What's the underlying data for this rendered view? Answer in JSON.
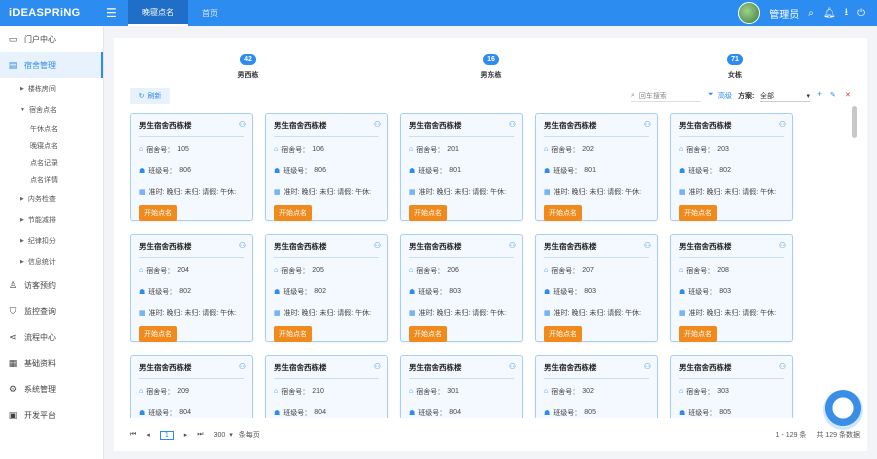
{
  "header": {
    "logo": "iDEASPRiNG",
    "tabs": [
      {
        "label": "晚寝点名",
        "active": true
      },
      {
        "label": "首页",
        "active": false
      }
    ],
    "user": "管理员"
  },
  "sidebar": {
    "items": [
      {
        "label": "门户中心",
        "icon": "monitor-icon"
      },
      {
        "label": "宿舍管理",
        "icon": "document-icon",
        "active": true
      },
      {
        "label": "楼栋房间",
        "type": "group"
      },
      {
        "label": "宿舍点名",
        "type": "group-open"
      },
      {
        "label": "午休点名",
        "type": "leaf"
      },
      {
        "label": "晚寝点名",
        "type": "leaf"
      },
      {
        "label": "点名记录",
        "type": "leaf"
      },
      {
        "label": "点名详情",
        "type": "leaf"
      },
      {
        "label": "内务检查",
        "type": "group"
      },
      {
        "label": "节能减排",
        "type": "group"
      },
      {
        "label": "纪律扣分",
        "type": "group"
      },
      {
        "label": "信息统计",
        "type": "group"
      },
      {
        "label": "访客预约",
        "icon": "user-icon"
      },
      {
        "label": "监控查询",
        "icon": "shield-icon"
      },
      {
        "label": "流程中心",
        "icon": "share-icon"
      },
      {
        "label": "基础资料",
        "icon": "grid-icon"
      },
      {
        "label": "系统管理",
        "icon": "gear-icon"
      },
      {
        "label": "开发平台",
        "icon": "code-icon"
      }
    ]
  },
  "stats": [
    {
      "count": "42",
      "label": "男西栋"
    },
    {
      "count": "16",
      "label": "男东栋"
    },
    {
      "count": "71",
      "label": "女栋"
    }
  ],
  "toolbar": {
    "refresh": "刷新",
    "search_placeholder": "回车搜索",
    "advanced": "高级",
    "scheme_label": "方案:",
    "scheme_value": "全部"
  },
  "card_labels": {
    "dorm": "宿舍号：",
    "class": "班级号：",
    "status": "准时: 晚归: 未归: 请假: 午休:",
    "button": "开始点名"
  },
  "cards": [
    {
      "title": "男生宿舍西栋楼",
      "dorm": "105",
      "class": "806"
    },
    {
      "title": "男生宿舍西栋楼",
      "dorm": "106",
      "class": "806"
    },
    {
      "title": "男生宿舍西栋楼",
      "dorm": "201",
      "class": "801"
    },
    {
      "title": "男生宿舍西栋楼",
      "dorm": "202",
      "class": "801"
    },
    {
      "title": "男生宿舍西栋楼",
      "dorm": "203",
      "class": "802"
    },
    {
      "title": "男生宿舍西栋楼",
      "dorm": "204",
      "class": "802"
    },
    {
      "title": "男生宿舍西栋楼",
      "dorm": "205",
      "class": "802"
    },
    {
      "title": "男生宿舍西栋楼",
      "dorm": "206",
      "class": "803"
    },
    {
      "title": "男生宿舍西栋楼",
      "dorm": "207",
      "class": "803"
    },
    {
      "title": "男生宿舍西栋楼",
      "dorm": "208",
      "class": "803"
    },
    {
      "title": "男生宿舍西栋楼",
      "dorm": "209",
      "class": "804"
    },
    {
      "title": "男生宿舍西栋楼",
      "dorm": "210",
      "class": "804"
    },
    {
      "title": "男生宿舍西栋楼",
      "dorm": "301",
      "class": "804"
    },
    {
      "title": "男生宿舍西栋楼",
      "dorm": "302",
      "class": "805"
    },
    {
      "title": "男生宿舍西栋楼",
      "dorm": "303",
      "class": "805"
    }
  ],
  "pager": {
    "page": "1",
    "size": "300",
    "size_suffix": "条每页",
    "range": "1 - 129 条",
    "total": "共 129 条数据"
  }
}
